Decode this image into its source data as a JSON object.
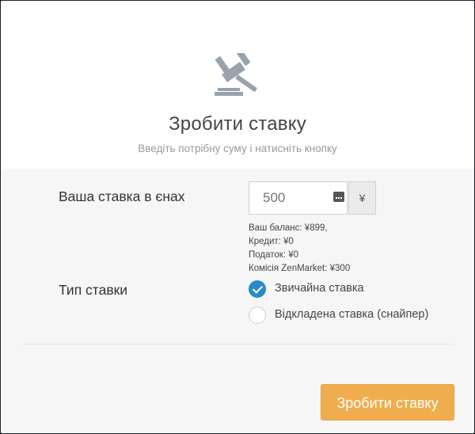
{
  "modal": {
    "close_symbol": "×",
    "hero_icon": "gavel-icon",
    "title": "Зробити ставку",
    "subtitle": "Введіть потрібну суму і натисніть кнопку"
  },
  "bid": {
    "label": "Ваша ставка в єнах",
    "amount_value": "",
    "amount_placeholder": "500",
    "currency_symbol": "¥",
    "calculator_icon": "calculator-icon",
    "balance": "Ваш баланс: ¥899,",
    "credit": "Кредит: ¥0",
    "tax": "Податок: ¥0",
    "commission": "Комісія ZenMarket: ¥300"
  },
  "bid_type": {
    "label": "Тип ставки",
    "options": [
      {
        "label": "Звичайна ставка",
        "checked": true
      },
      {
        "label": "Відкладена ставка (снайпер)",
        "checked": false
      }
    ]
  },
  "actions": {
    "submit_label": "Зробити ставку"
  },
  "colors": {
    "accent_button": "#f0ad4e",
    "radio_checked": "#2a8ac8",
    "body_background": "#f6f6f6"
  }
}
